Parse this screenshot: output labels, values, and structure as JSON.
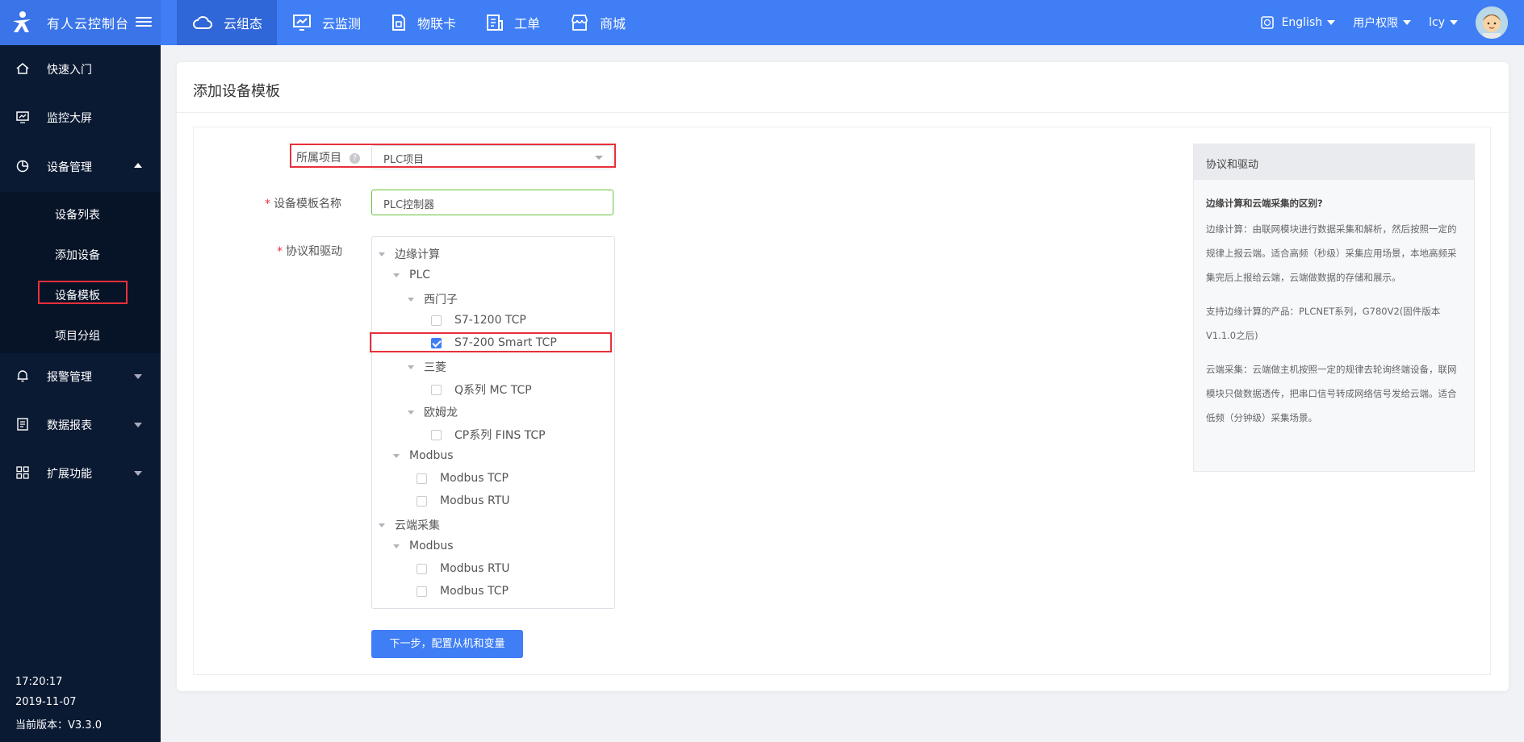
{
  "topbar": {
    "brand": "有人云控制台",
    "nav": [
      {
        "label": "云组态",
        "icon": "cloud-icon",
        "active": true
      },
      {
        "label": "云监测",
        "icon": "monitor-chart-icon",
        "active": false
      },
      {
        "label": "物联卡",
        "icon": "sim-card-icon",
        "active": false
      },
      {
        "label": "工单",
        "icon": "ticket-icon",
        "active": false
      },
      {
        "label": "商城",
        "icon": "shop-icon",
        "active": false
      }
    ],
    "language": "English",
    "permissions": "用户权限",
    "user": "lcy"
  },
  "sidebar": {
    "items": [
      {
        "label": "快速入门",
        "icon": "home-icon"
      },
      {
        "label": "监控大屏",
        "icon": "screen-icon"
      },
      {
        "label": "设备管理",
        "icon": "pie-icon"
      },
      {
        "label": "报警管理",
        "icon": "bell-icon"
      },
      {
        "label": "数据报表",
        "icon": "report-icon"
      },
      {
        "label": "扩展功能",
        "icon": "grid-icon"
      }
    ],
    "sub_items": [
      "设备列表",
      "添加设备",
      "设备模板",
      "项目分组"
    ],
    "footer": {
      "time": "17:20:17",
      "date": "2019-11-07",
      "version": "当前版本：V3.3.0"
    }
  },
  "page": {
    "title": "添加设备模板",
    "fields": {
      "project_label": "所属项目",
      "project_value": "PLC项目",
      "name_label": "设备模板名称",
      "name_value": "PLC控制器",
      "protocol_label": "协议和驱动"
    },
    "tree": [
      {
        "label": "边缘计算",
        "type": "branch"
      },
      {
        "label": "PLC",
        "type": "branch"
      },
      {
        "label": "西门子",
        "type": "branch"
      },
      {
        "label": "S7-1200 TCP",
        "type": "leaf",
        "checked": false
      },
      {
        "label": "S7-200 Smart TCP",
        "type": "leaf",
        "checked": true
      },
      {
        "label": "三菱",
        "type": "branch"
      },
      {
        "label": "Q系列 MC TCP",
        "type": "leaf",
        "checked": false
      },
      {
        "label": "欧姆龙",
        "type": "branch"
      },
      {
        "label": "CP系列 FINS TCP",
        "type": "leaf",
        "checked": false
      },
      {
        "label": "Modbus",
        "type": "branch"
      },
      {
        "label": "Modbus TCP",
        "type": "leaf",
        "checked": false
      },
      {
        "label": "Modbus RTU",
        "type": "leaf",
        "checked": false
      },
      {
        "label": "云端采集",
        "type": "branch"
      },
      {
        "label": "Modbus",
        "type": "branch"
      },
      {
        "label": "Modbus RTU",
        "type": "leaf",
        "checked": false
      },
      {
        "label": "Modbus TCP",
        "type": "leaf",
        "checked": false
      }
    ],
    "next_button": "下一步，配置从机和变量",
    "help": {
      "title": "协议和驱动",
      "question": "边缘计算和云端采集的区别?",
      "p1": "边缘计算：由联网模块进行数据采集和解析，然后按照一定的规律上报云端。适合高频（秒级）采集应用场景，本地高频采集完后上报给云端，云端做数据的存储和展示。",
      "p2": "支持边缘计算的产品：PLCNET系列，G780V2(固件版本V1.1.0之后)",
      "p3": "云端采集：云端做主机按照一定的规律去轮询终端设备，联网模块只做数据透传，把串口信号转成网络信号发给云端。适合低频（分钟级）采集场景。"
    }
  },
  "colors": {
    "primary": "#3f7ef5",
    "sidebar": "#0b1a33",
    "highlight": "#e8303a"
  }
}
